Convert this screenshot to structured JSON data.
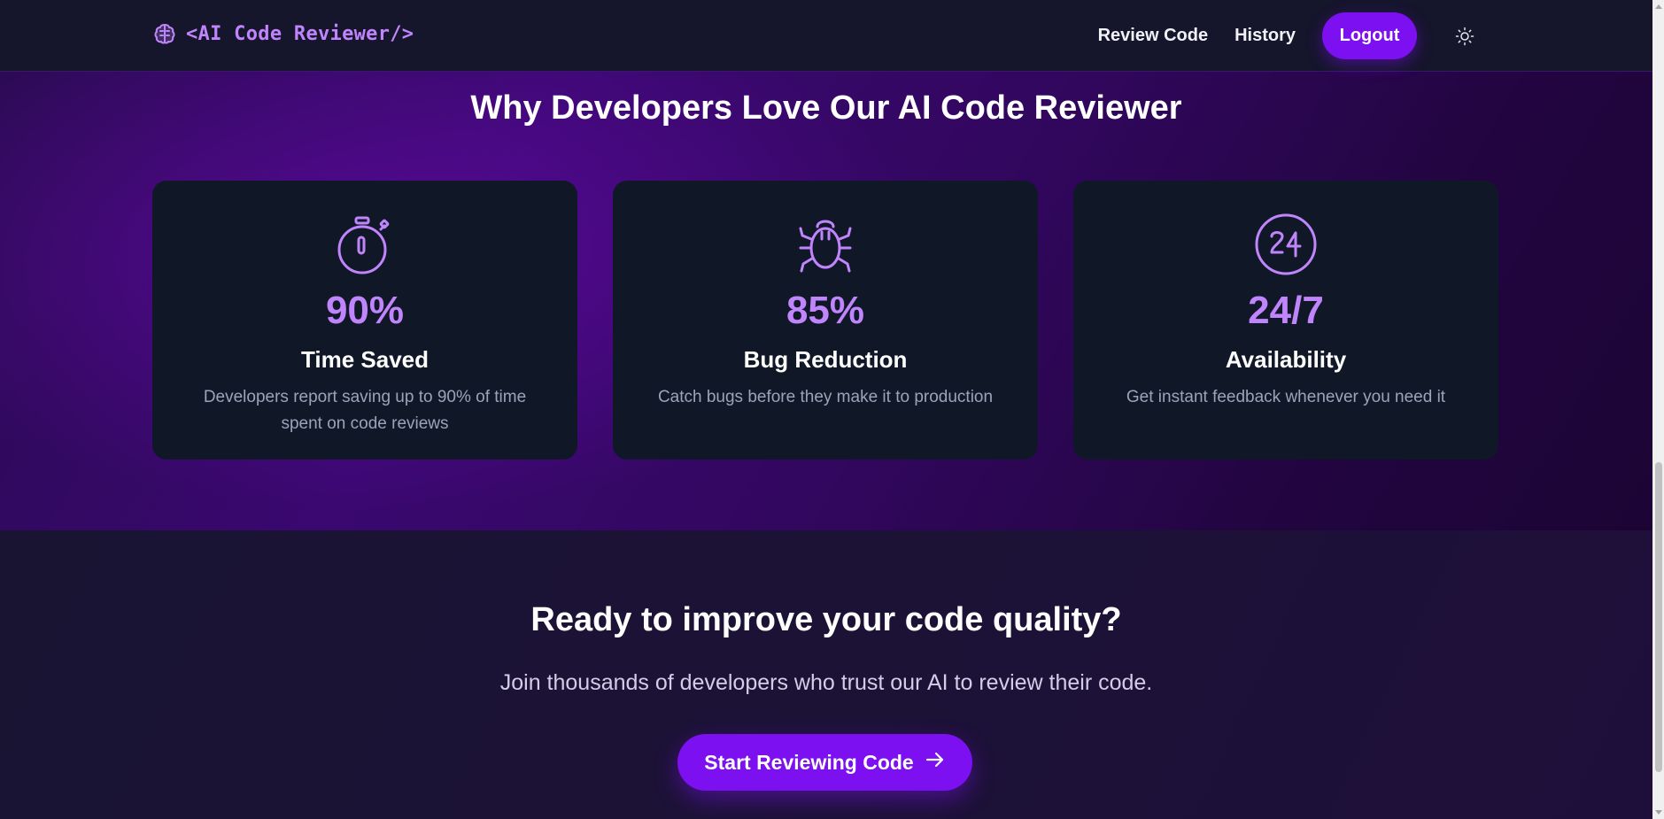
{
  "nav": {
    "brand": "<AI Code Reviewer/>",
    "brand_icon": "brain-icon",
    "links": [
      "Review Code",
      "History"
    ],
    "logout_label": "Logout",
    "theme_icon": "sun-icon"
  },
  "stats": {
    "title": "Why Developers Love Our AI Code Reviewer",
    "cards": [
      {
        "icon": "stopwatch-icon",
        "value": "90%",
        "label": "Time Saved",
        "desc": "Developers report saving up to 90% of time spent on code reviews"
      },
      {
        "icon": "bug-icon",
        "value": "85%",
        "label": "Bug Reduction",
        "desc": "Catch bugs before they make it to production"
      },
      {
        "icon": "24-hours-icon",
        "value": "24/7",
        "label": "Availability",
        "desc": "Get instant feedback whenever you need it"
      }
    ]
  },
  "cta": {
    "title": "Ready to improve your code quality?",
    "subtitle": "Join thousands of developers who trust our AI to review their code.",
    "button_label": "Start Reviewing Code",
    "button_icon": "arrow-right-icon"
  },
  "colors": {
    "accent": "#7c10f0",
    "accent_text": "#c084fc",
    "card_bg": "#101828",
    "nav_bg": "#15152b"
  }
}
